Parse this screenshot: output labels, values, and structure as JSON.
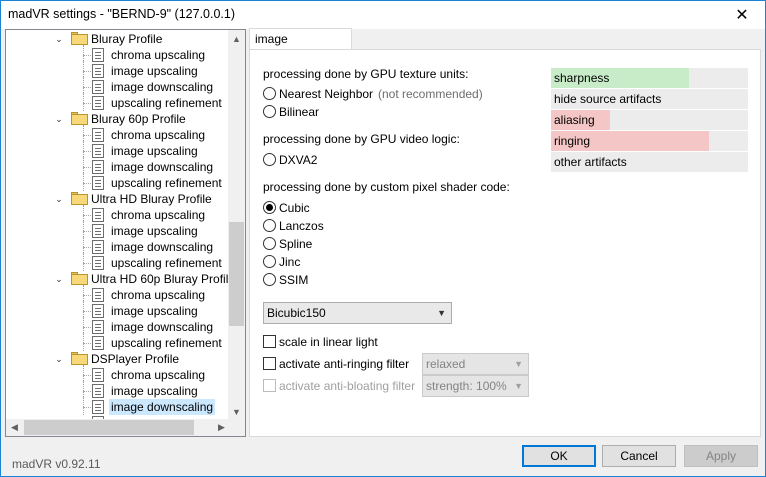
{
  "window": {
    "title": "madVR settings - \"BERND-9\" (127.0.0.1)"
  },
  "tree": {
    "rows": [
      {
        "kind": "folder",
        "label": "Bluray Profile"
      },
      {
        "kind": "page",
        "label": "chroma upscaling"
      },
      {
        "kind": "page",
        "label": "image upscaling"
      },
      {
        "kind": "page",
        "label": "image downscaling"
      },
      {
        "kind": "page",
        "label": "upscaling refinement"
      },
      {
        "kind": "folder",
        "label": "Bluray 60p Profile"
      },
      {
        "kind": "page",
        "label": "chroma upscaling"
      },
      {
        "kind": "page",
        "label": "image upscaling"
      },
      {
        "kind": "page",
        "label": "image downscaling"
      },
      {
        "kind": "page",
        "label": "upscaling refinement"
      },
      {
        "kind": "folder",
        "label": "Ultra HD Bluray Profile"
      },
      {
        "kind": "page",
        "label": "chroma upscaling"
      },
      {
        "kind": "page",
        "label": "image upscaling"
      },
      {
        "kind": "page",
        "label": "image downscaling"
      },
      {
        "kind": "page",
        "label": "upscaling refinement"
      },
      {
        "kind": "folder",
        "label": "Ultra HD 60p Bluray Profile"
      },
      {
        "kind": "page",
        "label": "chroma upscaling"
      },
      {
        "kind": "page",
        "label": "image upscaling"
      },
      {
        "kind": "page",
        "label": "image downscaling"
      },
      {
        "kind": "page",
        "label": "upscaling refinement"
      },
      {
        "kind": "folder",
        "label": "DSPlayer Profile"
      },
      {
        "kind": "page",
        "label": "chroma upscaling"
      },
      {
        "kind": "page",
        "label": "image upscaling"
      },
      {
        "kind": "page",
        "label": "image downscaling",
        "selected": true
      }
    ]
  },
  "tab": {
    "label": "image downscaling"
  },
  "sections": {
    "gpu_texture": "processing done by GPU texture units:",
    "gpu_video": "processing done by GPU video logic:",
    "pixel_shader": "processing done by custom pixel shader code:"
  },
  "options": {
    "nearest": "Nearest Neighbor",
    "nearest_hint": "(not recommended)",
    "bilinear": "Bilinear",
    "dxva2": "DXVA2",
    "cubic": "Cubic",
    "lanczos": "Lanczos",
    "spline": "Spline",
    "jinc": "Jinc",
    "ssim": "SSIM",
    "selected": "cubic"
  },
  "filter_select": {
    "value": "Bicubic150"
  },
  "checks": {
    "linear_light": "scale in linear light",
    "anti_ringing": "activate anti-ringing filter",
    "anti_ringing_value": "relaxed",
    "anti_bloating": "activate anti-bloating filter",
    "anti_bloating_value": "strength: 100%"
  },
  "quality_bars": [
    {
      "label": "sharpness",
      "level": 0.7,
      "color": "#c8ecc8"
    },
    {
      "label": "hide source artifacts",
      "level": 0,
      "color": "#ececec"
    },
    {
      "label": "aliasing",
      "level": 0.3,
      "color": "#f4c6c6"
    },
    {
      "label": "ringing",
      "level": 0.8,
      "color": "#f4c6c6"
    },
    {
      "label": "other artifacts",
      "level": 0,
      "color": "#ececec"
    }
  ],
  "footer": {
    "version": "madVR v0.92.11",
    "ok": "OK",
    "cancel": "Cancel",
    "apply": "Apply"
  }
}
